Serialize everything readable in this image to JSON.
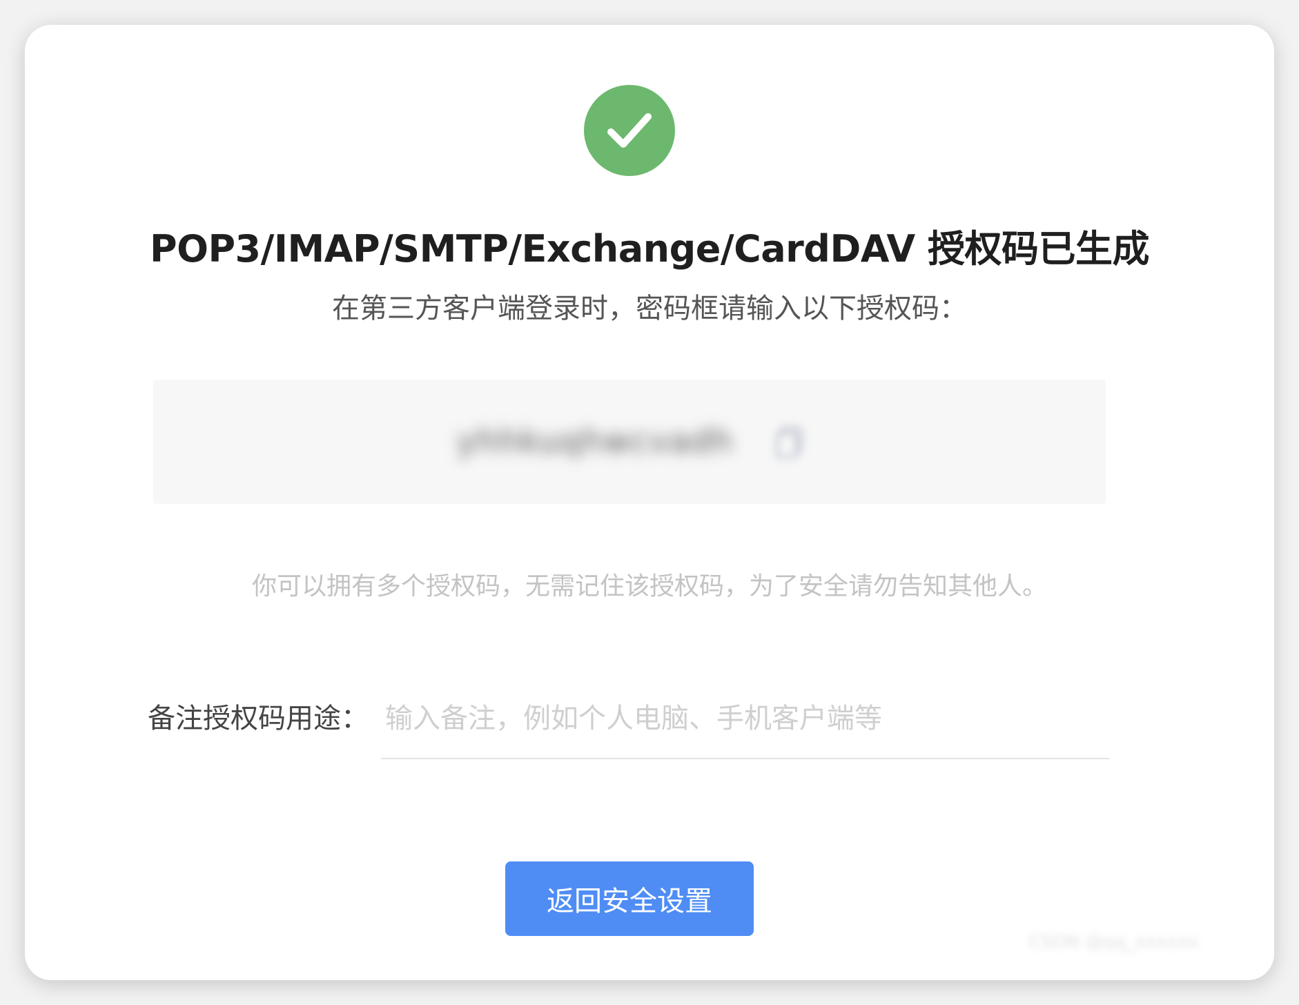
{
  "dialog": {
    "title": "POP3/IMAP/SMTP/Exchange/CardDAV 授权码已生成",
    "subtitle": "在第三方客户端登录时，密码框请输入以下授权码：",
    "auth_code": {
      "value": "yhhkuqhwcvadh",
      "copy_icon": "copy-icon",
      "blurred": true
    },
    "hint": "你可以拥有多个授权码，无需记住该授权码，为了安全请勿告知其他人。",
    "remark": {
      "label": "备注授权码用途：",
      "placeholder": "输入备注，例如个人电脑、手机客户端等",
      "value": ""
    },
    "back_button_label": "返回安全设置",
    "status_icon": "check-circle-icon",
    "watermark": "CSDN @qq_xxxxxx"
  },
  "colors": {
    "success_green": "#6cb86e",
    "primary_blue": "#4f8df5",
    "code_box_bg": "#f7f7f7",
    "hint_gray": "#c3c3c3"
  }
}
